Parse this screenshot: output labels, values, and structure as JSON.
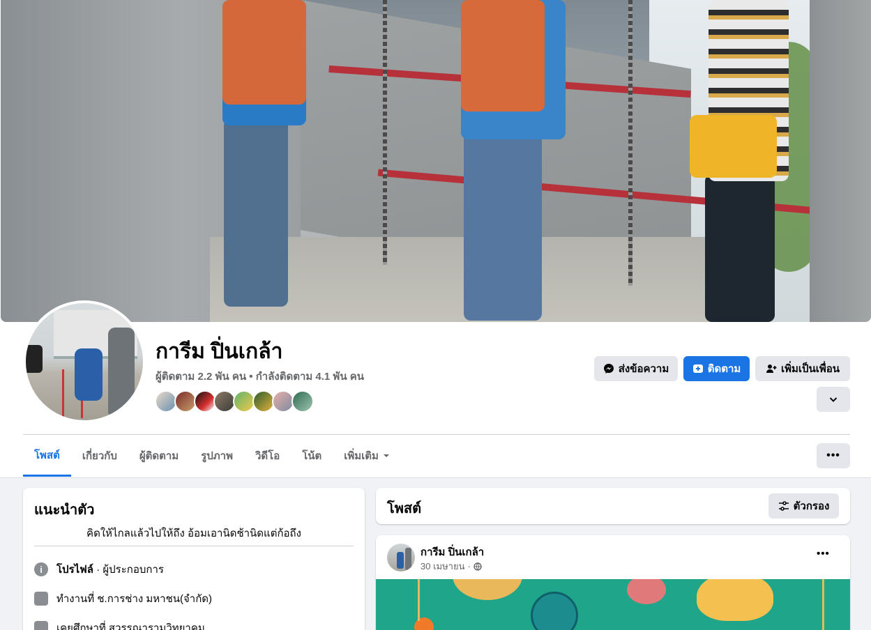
{
  "colors": {
    "accent": "#1b74e4",
    "secondary_text": "#65676b",
    "button_grey": "#e4e6eb",
    "background": "#f0f2f5"
  },
  "profile": {
    "name": "การีม ปิ่นเกล้า",
    "stats": "ผู้ติดตาม 2.2 พัน คน • กำลังติดตาม 4.1 พัน คน"
  },
  "actions": {
    "message_label": "ส่งข้อความ",
    "follow_label": "ติดตาม",
    "add_friend_label": "เพิ่มเป็นเพื่อน"
  },
  "tabs": [
    {
      "label": "โพสต์"
    },
    {
      "label": "เกี่ยวกับ"
    },
    {
      "label": "ผู้ติดตาม"
    },
    {
      "label": "รูปภาพ"
    },
    {
      "label": "วิดีโอ"
    },
    {
      "label": "โน้ต"
    },
    {
      "label": "เพิ่มเติม"
    }
  ],
  "intro": {
    "title": "แนะนำตัว",
    "bio": "คิดให้ไกลแล้วไปให้ถึง อ้อมเอานิดช้านิดแต่ก้อถึง",
    "profile_type_bold": "โปรไฟล์",
    "profile_type_rest": " · ผู้ประกอบการ",
    "work": "ทำงานที่ ช.การช่าง มหาชน(จำกัด)",
    "education": "เคยศึกษาที่ สุวรรณารามวิทยาคม"
  },
  "posts_header": {
    "title": "โพสต์",
    "filter_label": "ตัวกรอง"
  },
  "post": {
    "author": "การีม ปิ่นเกล้า",
    "date": "30 เมษายน",
    "separator": "·"
  }
}
